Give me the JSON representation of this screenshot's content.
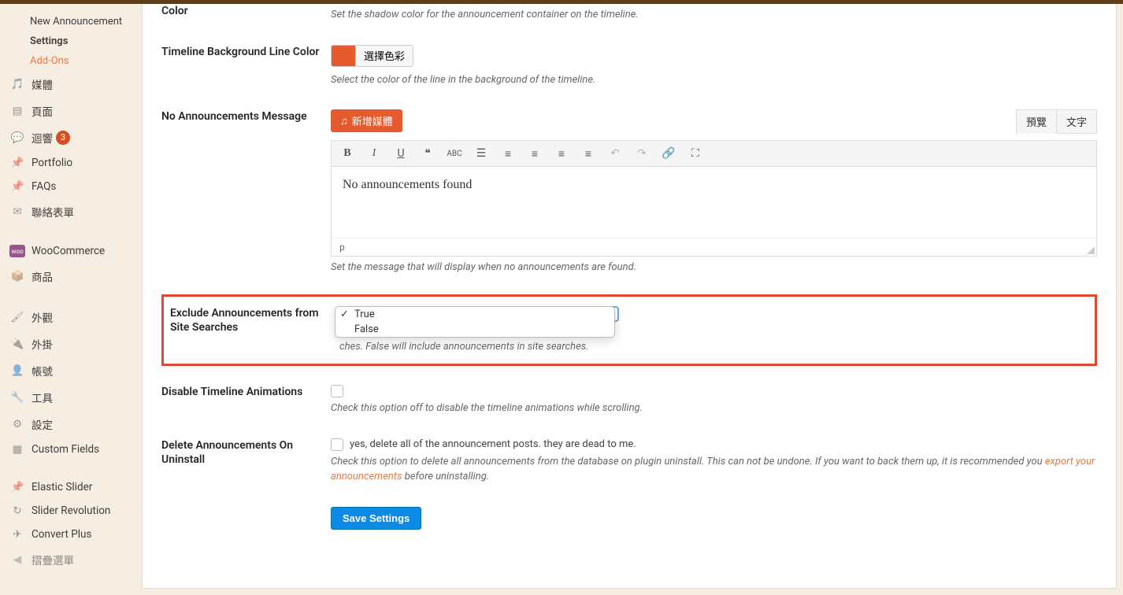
{
  "sidebar": {
    "sub": {
      "new_announcement": "New Announcement",
      "settings": "Settings",
      "addons": "Add-Ons"
    },
    "items": {
      "media": "媒體",
      "pages": "頁面",
      "comments": "迴響",
      "comments_count": "3",
      "portfolio": "Portfolio",
      "faqs": "FAQs",
      "contact": "聯絡表單",
      "woocommerce": "WooCommerce",
      "products": "商品",
      "appearance": "外觀",
      "plugins": "外掛",
      "users": "帳號",
      "tools": "工具",
      "settings": "設定",
      "custom_fields": "Custom Fields",
      "elastic_slider": "Elastic Slider",
      "slider_revolution": "Slider Revolution",
      "convert_plus": "Convert Plus",
      "collapse": "摺疊選單"
    }
  },
  "rows": {
    "shadow_color": {
      "label": "Color",
      "help": "Set the shadow color for the announcement container on the timeline."
    },
    "bg_line": {
      "label": "Timeline Background Line Color",
      "btn": "選擇色彩",
      "help": "Select the color of the line in the background of the timeline."
    },
    "no_ann": {
      "label": "No Announcements Message",
      "media_btn": "新增媒體",
      "tab_visual": "預覽",
      "tab_text": "文字",
      "content": "No announcements found",
      "status": "p",
      "help": "Set the message that will display when no announcements are found."
    },
    "exclude": {
      "label": "Exclude Announcements from Site Searches",
      "opt_true": "True",
      "opt_false": "False",
      "help_partial": "ches. False will include announcements in site searches."
    },
    "disable_anim": {
      "label": "Disable Timeline Animations",
      "help": "Check this option off to disable the timeline animations while scrolling."
    },
    "delete": {
      "label": "Delete Announcements On Uninstall",
      "check_label": "yes, delete all of the announcement posts. they are dead to me.",
      "help_before": "Check this option to delete all announcements from the database on plugin uninstall. This can not be undone. If you want to back them up, it is recommended you ",
      "link": "export your announcements",
      "help_after": " before uninstalling."
    }
  },
  "save_label": "Save Settings"
}
